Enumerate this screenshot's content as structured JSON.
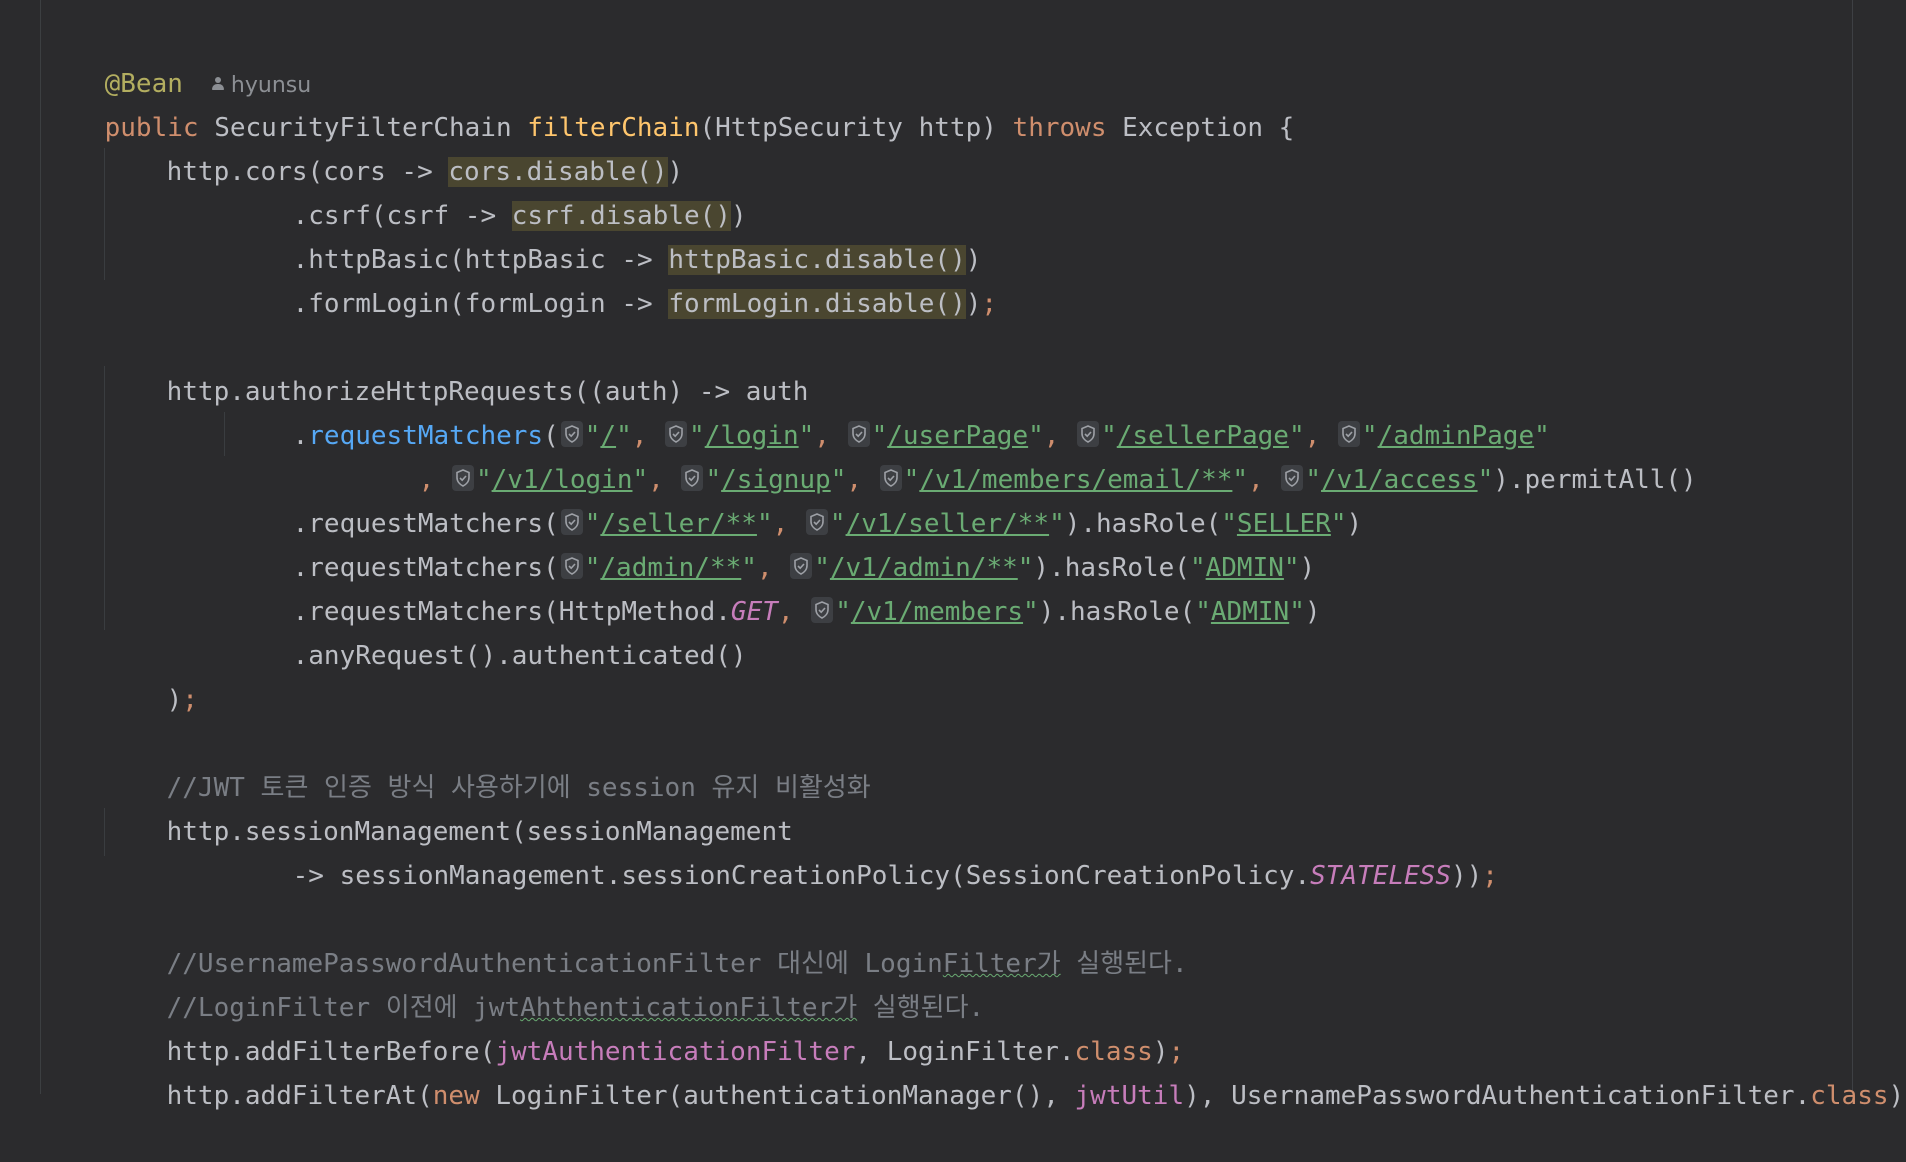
{
  "author": "hyunsu",
  "code": {
    "l01_annotation": "@Bean",
    "l02_public": "public",
    "l02_rettype": "SecurityFilterChain",
    "l02_method": "filterChain",
    "l02_params": "(HttpSecurity http)",
    "l02_throws": "throws",
    "l02_exc": "Exception {",
    "l03_a": "http.cors(cors -> ",
    "l03_hl": "cors.disable()",
    "l03_b": ")",
    "l04_a": ".csrf(csrf -> ",
    "l04_hl": "csrf.disable()",
    "l04_b": ")",
    "l05_a": ".httpBasic(httpBasic -> ",
    "l05_hl": "httpBasic.disable()",
    "l05_b": ")",
    "l06_a": ".formLogin(formLogin -> ",
    "l06_hl": "formLogin.disable()",
    "l06_b": ")",
    "semicolon": ";",
    "l08": "http.authorizeHttpRequests((auth) -> auth",
    "dot": ".",
    "request_matchers": "requestMatchers",
    "requestMatchers_plain": ".requestMatchers(",
    "open_paren": "(",
    "quote": "\"",
    "comma": ",",
    "close_paren": ")",
    "url_root": "/",
    "url_login": "/login",
    "url_userPage": "/userPage",
    "url_sellerPage": "/sellerPage",
    "url_adminPage": "/adminPage",
    "url_v1_login": "/v1/login",
    "url_signup": "/signup",
    "url_members_email": "/v1/members/email/**",
    "url_access": "/v1/access",
    "permit_all": ").permitAll()",
    "url_seller_all": "/seller/**",
    "url_v1_seller": "/v1/seller/**",
    "has_role_open": ").hasRole(",
    "role_seller": "SELLER",
    "url_admin_all": "/admin/**",
    "url_v1_admin": "/v1/admin/**",
    "role_admin": "ADMIN",
    "l13_a": ".requestMatchers(HttpMethod.",
    "l13_get": "GET",
    "url_v1_members": "/v1/members",
    "l14": ".anyRequest().authenticated()",
    "l15": ")",
    "l17_comment": "//JWT 토큰 인증 방식 사용하기에 session 유지 비활성화",
    "l18": "http.sessionManagement(sessionManagement",
    "l19_a": "-> sessionManagement.sessionCreationPolicy(SessionCreationPolicy.",
    "l19_stateless": "STATELESS",
    "l19_b": "))",
    "l21_comment_a": "//UsernamePasswordAuthenticationFilter 대신에 Login",
    "l21_comment_sq": "Filter가",
    "l21_comment_b": " 실행된다.",
    "l22_comment_a": "//LoginFilter 이전에 jwt",
    "l22_comment_sq": "AhthenticationFilter가",
    "l22_comment_b": " 실행된다.",
    "l23_a": "http.addFilterBefore(",
    "l23_field": "jwtAuthenticationFilter",
    "l23_b": ", LoginFilter.",
    "class_kw": "class",
    "l23_c": ")",
    "l24_a": "http.addFilterAt(",
    "new_kw": "new",
    "l24_b": " LoginFilter(authenticationManager(), ",
    "l24_field": "jwtUtil",
    "l24_c": "), UsernamePasswordAuthenticationFilter.",
    "l24_d": ")"
  },
  "colors": {
    "background": "#2b2b2d",
    "keyword": "#cf8e6d",
    "string": "#6aab73",
    "annotation": "#b3ae60",
    "method_decl": "#ffc66d",
    "method_call": "#56a8f5",
    "field": "#c77dbb",
    "comment": "#7a7e85",
    "text": "#bcbec4"
  },
  "icons": [
    "person-icon",
    "shield-icon"
  ]
}
